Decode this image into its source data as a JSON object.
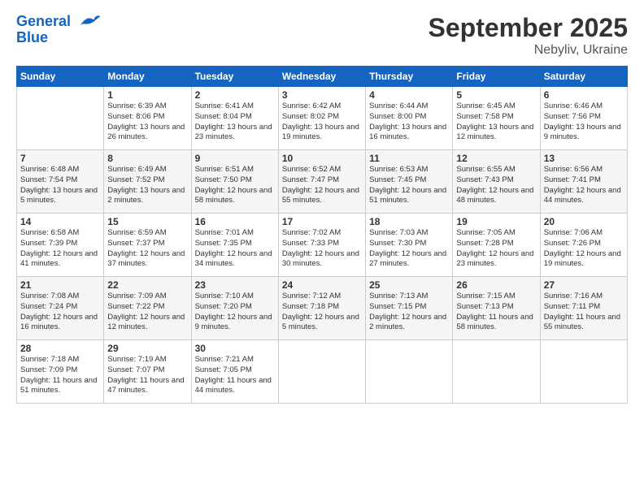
{
  "logo": {
    "line1": "General",
    "line2": "Blue"
  },
  "title": "September 2025",
  "subtitle": "Nebyliv, Ukraine",
  "weekdays": [
    "Sunday",
    "Monday",
    "Tuesday",
    "Wednesday",
    "Thursday",
    "Friday",
    "Saturday"
  ],
  "weeks": [
    [
      {
        "day": "",
        "sunrise": "",
        "sunset": "",
        "daylight": ""
      },
      {
        "day": "1",
        "sunrise": "Sunrise: 6:39 AM",
        "sunset": "Sunset: 8:06 PM",
        "daylight": "Daylight: 13 hours and 26 minutes."
      },
      {
        "day": "2",
        "sunrise": "Sunrise: 6:41 AM",
        "sunset": "Sunset: 8:04 PM",
        "daylight": "Daylight: 13 hours and 23 minutes."
      },
      {
        "day": "3",
        "sunrise": "Sunrise: 6:42 AM",
        "sunset": "Sunset: 8:02 PM",
        "daylight": "Daylight: 13 hours and 19 minutes."
      },
      {
        "day": "4",
        "sunrise": "Sunrise: 6:44 AM",
        "sunset": "Sunset: 8:00 PM",
        "daylight": "Daylight: 13 hours and 16 minutes."
      },
      {
        "day": "5",
        "sunrise": "Sunrise: 6:45 AM",
        "sunset": "Sunset: 7:58 PM",
        "daylight": "Daylight: 13 hours and 12 minutes."
      },
      {
        "day": "6",
        "sunrise": "Sunrise: 6:46 AM",
        "sunset": "Sunset: 7:56 PM",
        "daylight": "Daylight: 13 hours and 9 minutes."
      }
    ],
    [
      {
        "day": "7",
        "sunrise": "Sunrise: 6:48 AM",
        "sunset": "Sunset: 7:54 PM",
        "daylight": "Daylight: 13 hours and 5 minutes."
      },
      {
        "day": "8",
        "sunrise": "Sunrise: 6:49 AM",
        "sunset": "Sunset: 7:52 PM",
        "daylight": "Daylight: 13 hours and 2 minutes."
      },
      {
        "day": "9",
        "sunrise": "Sunrise: 6:51 AM",
        "sunset": "Sunset: 7:50 PM",
        "daylight": "Daylight: 12 hours and 58 minutes."
      },
      {
        "day": "10",
        "sunrise": "Sunrise: 6:52 AM",
        "sunset": "Sunset: 7:47 PM",
        "daylight": "Daylight: 12 hours and 55 minutes."
      },
      {
        "day": "11",
        "sunrise": "Sunrise: 6:53 AM",
        "sunset": "Sunset: 7:45 PM",
        "daylight": "Daylight: 12 hours and 51 minutes."
      },
      {
        "day": "12",
        "sunrise": "Sunrise: 6:55 AM",
        "sunset": "Sunset: 7:43 PM",
        "daylight": "Daylight: 12 hours and 48 minutes."
      },
      {
        "day": "13",
        "sunrise": "Sunrise: 6:56 AM",
        "sunset": "Sunset: 7:41 PM",
        "daylight": "Daylight: 12 hours and 44 minutes."
      }
    ],
    [
      {
        "day": "14",
        "sunrise": "Sunrise: 6:58 AM",
        "sunset": "Sunset: 7:39 PM",
        "daylight": "Daylight: 12 hours and 41 minutes."
      },
      {
        "day": "15",
        "sunrise": "Sunrise: 6:59 AM",
        "sunset": "Sunset: 7:37 PM",
        "daylight": "Daylight: 12 hours and 37 minutes."
      },
      {
        "day": "16",
        "sunrise": "Sunrise: 7:01 AM",
        "sunset": "Sunset: 7:35 PM",
        "daylight": "Daylight: 12 hours and 34 minutes."
      },
      {
        "day": "17",
        "sunrise": "Sunrise: 7:02 AM",
        "sunset": "Sunset: 7:33 PM",
        "daylight": "Daylight: 12 hours and 30 minutes."
      },
      {
        "day": "18",
        "sunrise": "Sunrise: 7:03 AM",
        "sunset": "Sunset: 7:30 PM",
        "daylight": "Daylight: 12 hours and 27 minutes."
      },
      {
        "day": "19",
        "sunrise": "Sunrise: 7:05 AM",
        "sunset": "Sunset: 7:28 PM",
        "daylight": "Daylight: 12 hours and 23 minutes."
      },
      {
        "day": "20",
        "sunrise": "Sunrise: 7:06 AM",
        "sunset": "Sunset: 7:26 PM",
        "daylight": "Daylight: 12 hours and 19 minutes."
      }
    ],
    [
      {
        "day": "21",
        "sunrise": "Sunrise: 7:08 AM",
        "sunset": "Sunset: 7:24 PM",
        "daylight": "Daylight: 12 hours and 16 minutes."
      },
      {
        "day": "22",
        "sunrise": "Sunrise: 7:09 AM",
        "sunset": "Sunset: 7:22 PM",
        "daylight": "Daylight: 12 hours and 12 minutes."
      },
      {
        "day": "23",
        "sunrise": "Sunrise: 7:10 AM",
        "sunset": "Sunset: 7:20 PM",
        "daylight": "Daylight: 12 hours and 9 minutes."
      },
      {
        "day": "24",
        "sunrise": "Sunrise: 7:12 AM",
        "sunset": "Sunset: 7:18 PM",
        "daylight": "Daylight: 12 hours and 5 minutes."
      },
      {
        "day": "25",
        "sunrise": "Sunrise: 7:13 AM",
        "sunset": "Sunset: 7:15 PM",
        "daylight": "Daylight: 12 hours and 2 minutes."
      },
      {
        "day": "26",
        "sunrise": "Sunrise: 7:15 AM",
        "sunset": "Sunset: 7:13 PM",
        "daylight": "Daylight: 11 hours and 58 minutes."
      },
      {
        "day": "27",
        "sunrise": "Sunrise: 7:16 AM",
        "sunset": "Sunset: 7:11 PM",
        "daylight": "Daylight: 11 hours and 55 minutes."
      }
    ],
    [
      {
        "day": "28",
        "sunrise": "Sunrise: 7:18 AM",
        "sunset": "Sunset: 7:09 PM",
        "daylight": "Daylight: 11 hours and 51 minutes."
      },
      {
        "day": "29",
        "sunrise": "Sunrise: 7:19 AM",
        "sunset": "Sunset: 7:07 PM",
        "daylight": "Daylight: 11 hours and 47 minutes."
      },
      {
        "day": "30",
        "sunrise": "Sunrise: 7:21 AM",
        "sunset": "Sunset: 7:05 PM",
        "daylight": "Daylight: 11 hours and 44 minutes."
      },
      {
        "day": "",
        "sunrise": "",
        "sunset": "",
        "daylight": ""
      },
      {
        "day": "",
        "sunrise": "",
        "sunset": "",
        "daylight": ""
      },
      {
        "day": "",
        "sunrise": "",
        "sunset": "",
        "daylight": ""
      },
      {
        "day": "",
        "sunrise": "",
        "sunset": "",
        "daylight": ""
      }
    ]
  ]
}
